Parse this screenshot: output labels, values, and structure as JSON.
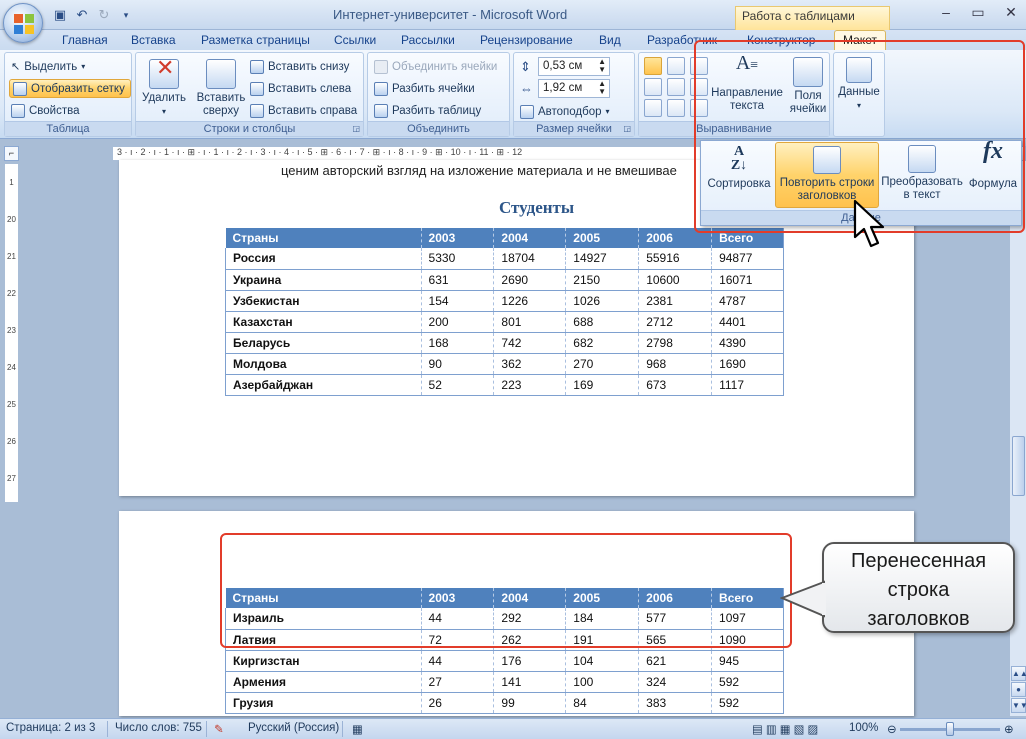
{
  "window": {
    "title": "Интернет-университет - Microsoft Word",
    "context_group": "Работа с таблицами"
  },
  "tabs": [
    "Главная",
    "Вставка",
    "Разметка страницы",
    "Ссылки",
    "Рассылки",
    "Рецензирование",
    "Вид",
    "Разработчик",
    "Конструктор",
    "Макет"
  ],
  "ribbon": {
    "table": {
      "label": "Таблица",
      "select": "Выделить",
      "show_grid": "Отобразить сетку",
      "properties": "Свойства"
    },
    "rows_cols": {
      "label": "Строки и столбцы",
      "delete": "Удалить",
      "insert_above": "Вставить сверху",
      "insert_below": "Вставить снизу",
      "insert_left": "Вставить слева",
      "insert_right": "Вставить справа"
    },
    "merge": {
      "label": "Объединить",
      "merge_cells": "Объединить ячейки",
      "split_cells": "Разбить ячейки",
      "split_table": "Разбить таблицу"
    },
    "cell_size": {
      "label": "Размер ячейки",
      "height": "0,53 см",
      "width": "1,92 см",
      "autofit": "Автоподбор"
    },
    "alignment": {
      "label": "Выравнивание",
      "text_direction": "Направление текста",
      "margins": "Поля ячейки"
    },
    "data": {
      "label": "Данные",
      "button": "Данные",
      "sort": "Сортировка",
      "repeat_header": "Повторить строки заголовков",
      "convert": "Преобразовать в текст",
      "formula": "Формула"
    }
  },
  "document": {
    "intro_line": "ценим авторский взгляд на изложение материала и не вмешивае",
    "title": "Студенты",
    "headers": [
      "Страны",
      "2003",
      "2004",
      "2005",
      "2006",
      "Всего"
    ],
    "page1_rows": [
      [
        "Россия",
        "5330",
        "18704",
        "14927",
        "55916",
        "94877"
      ],
      [
        "Украина",
        "631",
        "2690",
        "2150",
        "10600",
        "16071"
      ],
      [
        "Узбекистан",
        "154",
        "1226",
        "1026",
        "2381",
        "4787"
      ],
      [
        "Казахстан",
        "200",
        "801",
        "688",
        "2712",
        "4401"
      ],
      [
        "Беларусь",
        "168",
        "742",
        "682",
        "2798",
        "4390"
      ],
      [
        "Молдова",
        "90",
        "362",
        "270",
        "968",
        "1690"
      ],
      [
        "Азербайджан",
        "52",
        "223",
        "169",
        "673",
        "1117"
      ]
    ],
    "page2_rows": [
      [
        "Израиль",
        "44",
        "292",
        "184",
        "577",
        "1097"
      ],
      [
        "Латвия",
        "72",
        "262",
        "191",
        "565",
        "1090"
      ],
      [
        "Киргизстан",
        "44",
        "176",
        "104",
        "621",
        "945"
      ],
      [
        "Армения",
        "27",
        "141",
        "100",
        "324",
        "592"
      ],
      [
        "Грузия",
        "26",
        "99",
        "84",
        "383",
        "592"
      ]
    ]
  },
  "callout": {
    "line1": "Перенесенная",
    "line2": "строка",
    "line3": "заголовков"
  },
  "statusbar": {
    "page": "Страница: 2 из 3",
    "words": "Число слов: 755",
    "language": "Русский (Россия)",
    "zoom": "100%"
  },
  "ruler": {
    "h_marks": "3 · ı · 2 · ı · 1 · ı · ⊞ · ı · 1 · ı · 2 · ı · 3 · ı · 4 · ı · 5 · ⊞ · 6 · ı · 7 · ⊞ · ı · 8 · ı · 9 · ⊞ · 10 · ı · 11 · ⊞ · 12",
    "v_marks": [
      "1",
      "20",
      "21",
      "22",
      "23",
      "24",
      "25",
      "26",
      "27"
    ]
  },
  "colors": {
    "accent": "#4f81bd",
    "highlight": "#e23c2a",
    "ribbon_active": "#ffc24d"
  }
}
